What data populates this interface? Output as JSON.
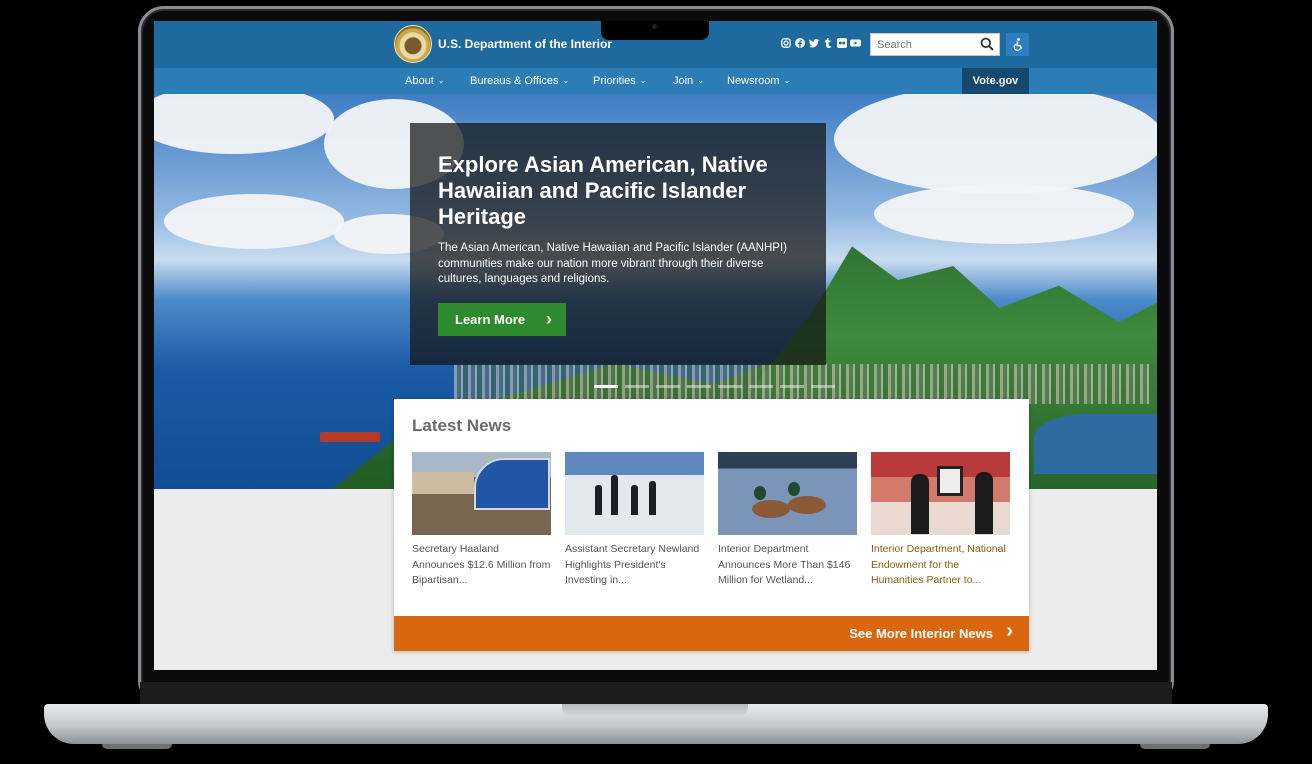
{
  "header": {
    "site_title": "U.S. Department of the Interior",
    "social_icons": [
      "instagram-icon",
      "facebook-icon",
      "twitter-icon",
      "tumblr-icon",
      "flickr-icon",
      "youtube-icon"
    ],
    "search": {
      "placeholder": "Search"
    },
    "accessibility_icon": "accessibility-icon"
  },
  "nav": {
    "items": [
      {
        "label": "About"
      },
      {
        "label": "Bureaus & Offices"
      },
      {
        "label": "Priorities"
      },
      {
        "label": "Join"
      },
      {
        "label": "Newsroom"
      }
    ],
    "vote_label": "Vote.gov"
  },
  "hero": {
    "title": "Explore Asian American, Native Hawaiian and Pacific Islander Heritage",
    "description": "The Asian American, Native Hawaiian and Pacific Islander (AANHPI) communities make our nation more vibrant through their diverse cultures, languages and religions.",
    "button_label": "Learn More",
    "slide_count": 8,
    "active_slide": 1
  },
  "news": {
    "heading": "Latest News",
    "items": [
      {
        "caption": "Secretary Haaland Announces $12.6 Million from Bipartisan..."
      },
      {
        "caption": "Assistant Secretary Newland Highlights President's Investing in..."
      },
      {
        "caption": "Interior Department Announces More Than $146 Million for Wetland..."
      },
      {
        "caption": "Interior Department, National Endowment for the Humanities Partner to..."
      }
    ],
    "see_more_label": "See More Interior News"
  },
  "colors": {
    "topbar": "#1e6a9e",
    "navbar": "#2c7cb6",
    "vote": "#14486f",
    "learn_button": "#2e8a2e",
    "see_more": "#d9670f"
  }
}
